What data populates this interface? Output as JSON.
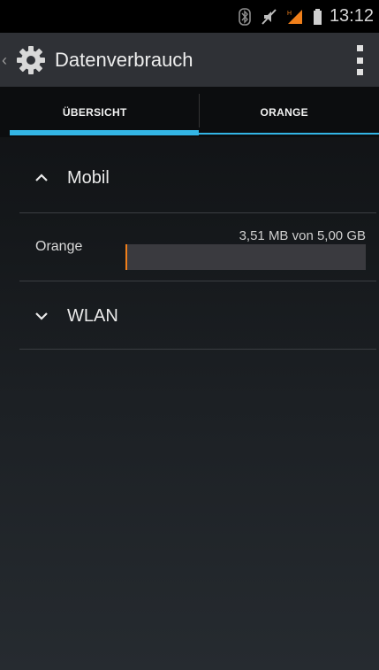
{
  "status_bar": {
    "time": "13:12",
    "icons": [
      "bluetooth-icon",
      "mute-icon",
      "signal-icon",
      "battery-icon"
    ]
  },
  "action_bar": {
    "title": "Datenverbrauch",
    "app_icon": "settings-gear-icon",
    "overflow_icon": "overflow-menu-icon"
  },
  "tabs": [
    {
      "label": "ÜBERSICHT",
      "active": true
    },
    {
      "label": "ORANGE",
      "active": false
    }
  ],
  "sections": {
    "mobile": {
      "label": "Mobil",
      "expanded": true,
      "networks": [
        {
          "name": "Orange",
          "usage": "3,51 MB von 5,00 GB",
          "fraction": 0.0007
        }
      ]
    },
    "wlan": {
      "label": "WLAN",
      "expanded": false
    }
  },
  "colors": {
    "accent": "#33b5e5",
    "usage_bar": "#f07f1a"
  }
}
